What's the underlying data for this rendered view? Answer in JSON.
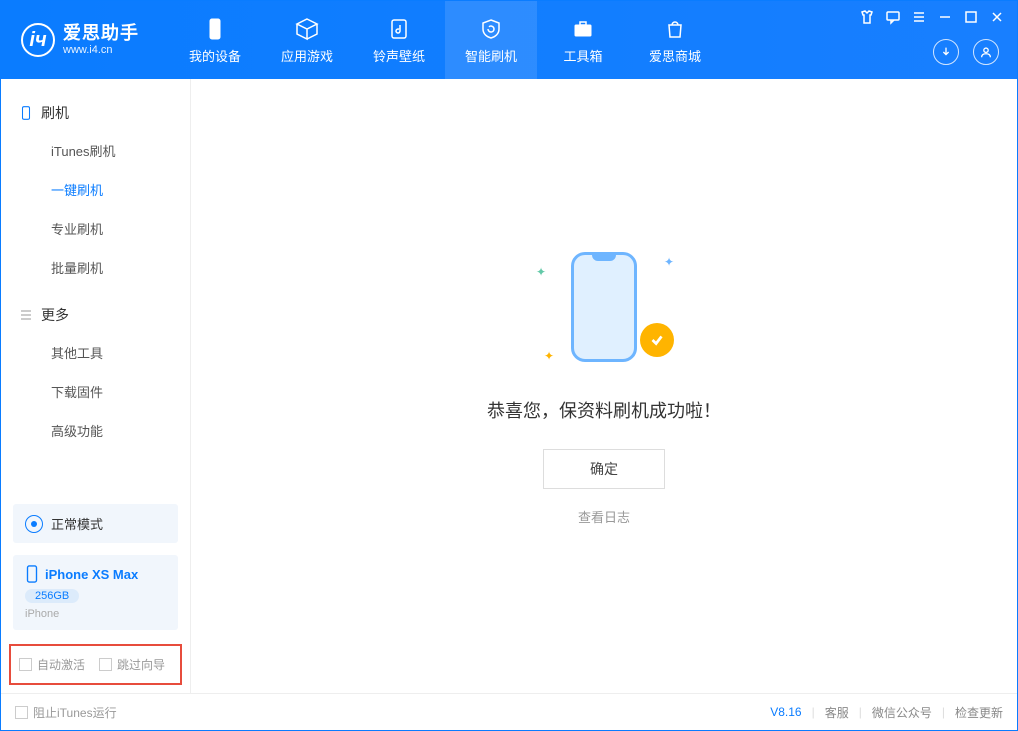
{
  "app": {
    "title": "爱思助手",
    "subtitle": "www.i4.cn"
  },
  "nav": {
    "device": "我的设备",
    "apps": "应用游戏",
    "media": "铃声壁纸",
    "flash": "智能刷机",
    "tools": "工具箱",
    "store": "爱思商城"
  },
  "sidebar": {
    "flash_head": "刷机",
    "itunes_flash": "iTunes刷机",
    "one_click": "一键刷机",
    "pro_flash": "专业刷机",
    "batch_flash": "批量刷机",
    "more_head": "更多",
    "other_tools": "其他工具",
    "download_fw": "下载固件",
    "advanced": "高级功能"
  },
  "mode": {
    "label": "正常模式"
  },
  "device": {
    "name": "iPhone XS Max",
    "capacity": "256GB",
    "type": "iPhone"
  },
  "options": {
    "auto_activate": "自动激活",
    "skip_guide": "跳过向导"
  },
  "main": {
    "success": "恭喜您，保资料刷机成功啦！",
    "ok": "确定",
    "view_log": "查看日志"
  },
  "footer": {
    "block_itunes": "阻止iTunes运行",
    "version": "V8.16",
    "support": "客服",
    "wechat": "微信公众号",
    "update": "检查更新"
  }
}
